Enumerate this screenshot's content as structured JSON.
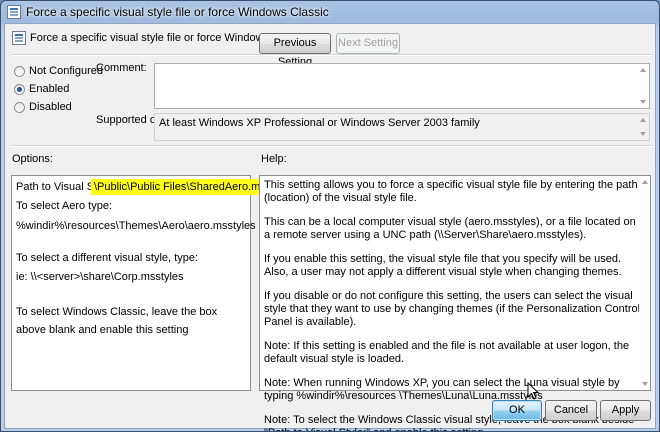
{
  "window": {
    "title": "Force a specific visual style file or force Windows Classic"
  },
  "header": {
    "title": "Force a specific visual style file or force Windows Classic",
    "prev_label": "Previous Setting",
    "next_label": "Next Setting"
  },
  "state": {
    "options": [
      {
        "label": "Not Configured",
        "checked": false
      },
      {
        "label": "Enabled",
        "checked": true
      },
      {
        "label": "Disabled",
        "checked": false
      }
    ]
  },
  "comment": {
    "label": "Comment:",
    "value": ""
  },
  "supported": {
    "label": "Supported on:",
    "value": "At least Windows XP Professional or Windows Server 2003 family"
  },
  "options_pane": {
    "heading": "Options:",
    "path_label": "Path to Visual Style:",
    "path_value": "\\Public\\Public Files\\SharedAero.msstyles",
    "lines": [
      "To select Aero type:",
      "%windir%\\resources\\Themes\\Aero\\aero.msstyles",
      "To select a different visual style, type:",
      "ie: \\\\<server>\\share\\Corp.msstyles",
      "To select Windows Classic, leave the box",
      "above blank and enable this setting"
    ]
  },
  "help_pane": {
    "heading": "Help:",
    "paragraphs": [
      "This setting allows you to force a specific visual style file by entering the path (location) of the visual style file.",
      "This can be a local computer visual style (aero.msstyles), or a file located on a remote server using a UNC path (\\\\Server\\Share\\aero.msstyles).",
      "If you enable this setting, the visual style file that you specify will be used. Also, a user may not apply a different visual style when changing themes.",
      "If you disable or do not configure this setting, the users can select the visual style that they want to use by changing themes (if the Personalization Control Panel is available).",
      "Note: If this setting is enabled and the file is not available at user logon, the default visual style is loaded.",
      "Note: When running Windows XP, you can select the Luna visual style by typing %windir%\\resources \\Themes\\Luna\\Luna.msstyles",
      "Note: To select the Windows Classic visual style, leave the box blank beside \"Path to Visual Style:\" and enable this setting."
    ]
  },
  "footer": {
    "ok_label": "OK",
    "cancel_label": "Cancel",
    "apply_label": "Apply"
  }
}
